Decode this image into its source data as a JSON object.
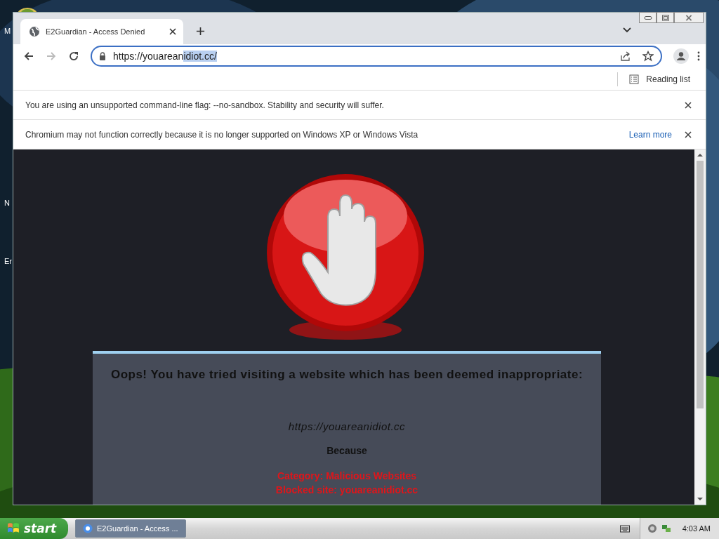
{
  "desktop": {
    "icons": [
      {
        "label": "M"
      },
      {
        "label": "N"
      },
      {
        "label": "Er"
      }
    ]
  },
  "browser": {
    "tabs": [
      {
        "title": "E2Guardian - Access Denied",
        "selected": true
      }
    ],
    "address_bar": {
      "url_parts": [
        {
          "text": "https://youarean",
          "selected": false
        },
        {
          "text": "idiot.cc/",
          "selected": true
        }
      ]
    },
    "reading_list": "Reading list",
    "infobars": [
      {
        "message": "You are using an unsupported command-line flag: --no-sandbox. Stability and security will suffer."
      },
      {
        "message": "Chromium may not function correctly because it is no longer supported on Windows XP or Windows Vista",
        "link": "Learn more"
      }
    ]
  },
  "page": {
    "heading": "Oops! You have tried visiting a website which has been deemed inappropriate:",
    "url": "https://youareanidiot.cc",
    "because": "Because",
    "reasons": [
      "Category: Malicious Websites",
      "Blocked site: youareanidiot.cc"
    ]
  },
  "taskbar": {
    "start": "start",
    "tasks": [
      {
        "title": "E2Guardian - Access ...",
        "selected": true
      }
    ],
    "clock": "4:03 AM"
  }
}
